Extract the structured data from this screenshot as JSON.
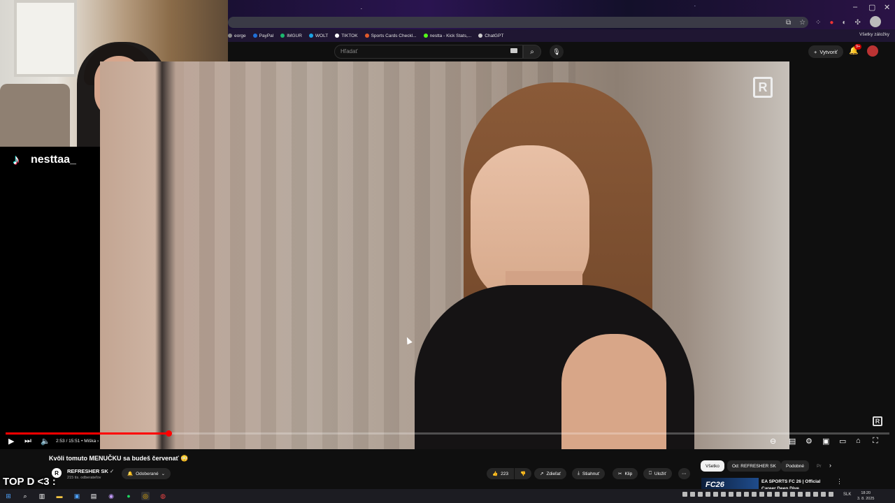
{
  "browser": {
    "bookmarks": [
      {
        "label": "eorge",
        "icon": "bookmark-icon",
        "color": "#888888"
      },
      {
        "label": "PayPal",
        "icon": "paypal-icon",
        "color": "#1f6fd8"
      },
      {
        "label": "IMGUR",
        "icon": "imgur-icon",
        "color": "#1bb76e"
      },
      {
        "label": "WOLT",
        "icon": "wolt-icon",
        "color": "#1aa4e5"
      },
      {
        "label": "TIKTOK",
        "icon": "tiktok-icon",
        "color": "#ffffff"
      },
      {
        "label": "Sports Cards Checkl...",
        "icon": "sports-cards-icon",
        "color": "#e05a2a"
      },
      {
        "label": "nestta - Kick Stats,...",
        "icon": "kick-icon",
        "color": "#53fc18"
      },
      {
        "label": "ChatGPT",
        "icon": "chatgpt-icon",
        "color": "#cccccc"
      }
    ],
    "all_bookmarks_label": "Všetky záložky"
  },
  "youtube": {
    "search_placeholder": "Hľadať",
    "create_label": "Vytvoriť",
    "notification_count": "9+"
  },
  "stream": {
    "tiktok_handle": "nesttaa_",
    "overlay_text": "TOP D <3 :"
  },
  "player": {
    "time": "2:53 / 15:51",
    "chapter": "• Miška",
    "progress_fraction": 0.184,
    "buffered_fraction": 0.205
  },
  "video_info": {
    "title": "Kvôli tomuto MENUČKU sa budeš červenať 😳",
    "channel_name": "REFRESHER SK",
    "channel_logo_letter": "R",
    "subscribers": "215 tis. odberateľov",
    "subscribe_state": "Odoberané",
    "likes": "223",
    "share_label": "Zdieľať",
    "download_label": "Stiahnuť",
    "clip_label": "Klip",
    "save_label": "Uložiť"
  },
  "sidebar_chips": [
    {
      "label": "Všetko",
      "active": true
    },
    {
      "label": "Od: REFRESHER SK",
      "active": false
    },
    {
      "label": "Podobné",
      "active": false
    },
    {
      "label": "Pr",
      "active": false
    }
  ],
  "recommendation": {
    "thumb_text": "FC26",
    "title_line1": "EA SPORTS FC 26 | Official",
    "title_line2": "Career Deep Dive"
  },
  "taskbar": {
    "lang": "SLK",
    "time": "18:20",
    "date": "3. 8. 2025"
  }
}
